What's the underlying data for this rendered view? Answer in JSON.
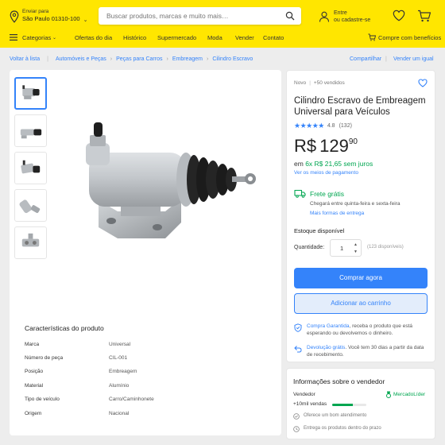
{
  "header": {
    "location_line1": "Enviar para",
    "location_line2": "São Paulo 01310-100",
    "search_placeholder": "Buscar produtos, marcas e muito mais…",
    "account_line1": "Entre",
    "account_line2": "ou cadastre-se",
    "brand_color": "#ffe600"
  },
  "nav": {
    "categories": "Categorias",
    "items": [
      "Ofertas do dia",
      "Histórico",
      "Supermercado",
      "Moda",
      "Vender",
      "Contato"
    ],
    "benefits": "Compre com benefícios"
  },
  "breadcrumb": {
    "back": "Voltar à lista",
    "items": [
      "Automóveis e Peças",
      "Peças para Carros",
      "Embreagem",
      "Cilindro Escravo"
    ],
    "share": "Compartilhar",
    "sell_same": "Vender um igual"
  },
  "gallery": {
    "thumbnails": [
      "front view",
      "side view",
      "angled view",
      "fitting detail",
      "mount detail"
    ],
    "selected_index": 0
  },
  "specs": {
    "title": "Características do produto",
    "rows": [
      {
        "key": "Marca",
        "value": "Universal"
      },
      {
        "key": "Número de peça",
        "value": "CIL-001"
      },
      {
        "key": "Posição",
        "value": "Embreagem"
      },
      {
        "key": "Material",
        "value": "Alumínio"
      },
      {
        "key": "Tipo de veículo",
        "value": "Carro/Caminhonete"
      },
      {
        "key": "Origem",
        "value": "Nacional"
      }
    ]
  },
  "product": {
    "condition": "Novo",
    "sold": "+50 vendidos",
    "title": "Cilindro Escravo de Embreagem Universal para Veículos",
    "rating_value": "4.8",
    "rating_count": "(132)",
    "stars": 4.5,
    "price_currency": "R$",
    "price_int": "129",
    "price_cents": "90",
    "installments_prefix": "em",
    "installments": "6x R$ 21,65 sem juros",
    "payment_link": "Ver os meios de pagamento",
    "shipping_title": "Frete grátis",
    "shipping_eta": "Chegará entre quinta-feira e sexta-feira",
    "shipping_more": "Mais formas de entrega",
    "stock": "Estoque disponível",
    "qty_label": "Quantidade:",
    "qty_value": "1",
    "qty_available": "(123 disponíveis)",
    "buy_button": "Comprar agora",
    "cart_button": "Adicionar ao carrinho",
    "guarantee_link": "Compra Garantida",
    "guarantee_text": ", receba o produto que está esperando ou devolvemos o dinheiro.",
    "return_link": "Devolução grátis",
    "return_text": ". Você tem 30 dias a partir da data de recebimento.",
    "accent_color": "#3483fa",
    "green_color": "#00a650"
  },
  "seller": {
    "title": "Informações sobre o vendedor",
    "label": "Vendedor",
    "badge": "MercadoLíder",
    "sales": "+10mil vendas",
    "reputation_fraction": 0.6,
    "bullet1": "Oferece um bom atendimento",
    "bullet2": "Entrega os produtos dentro do prazo"
  }
}
